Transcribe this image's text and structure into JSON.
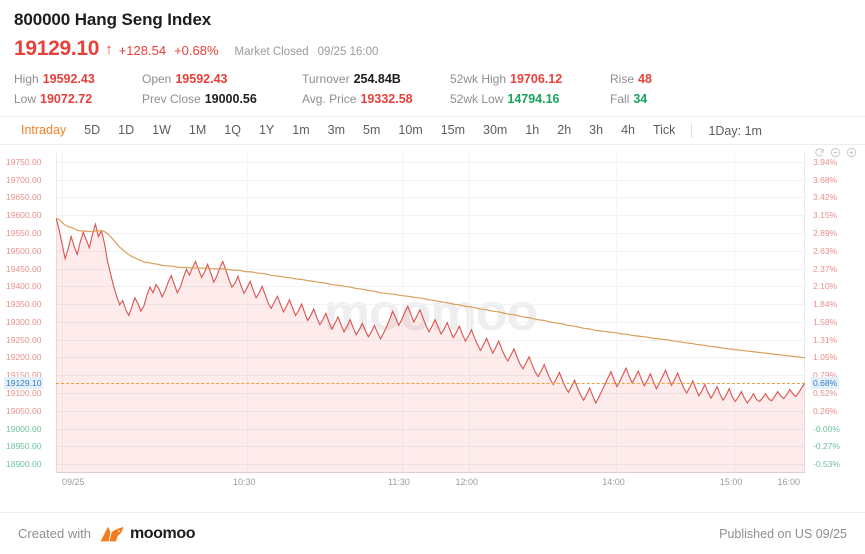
{
  "header": {
    "symbol_title": "800000 Hang Seng Index",
    "last_price": "19129.10",
    "arrow": "↑",
    "change": "+128.54",
    "change_pct": "+0.68%",
    "market_status": "Market Closed",
    "market_time": "09/25 16:00",
    "accent_up": "#e8403a",
    "accent_down": "#18a45b"
  },
  "stats": {
    "col1": [
      {
        "label": "High",
        "value": "19592.43",
        "color": "red"
      },
      {
        "label": "Low",
        "value": "19072.72",
        "color": "red"
      }
    ],
    "col2": [
      {
        "label": "Open",
        "value": "19592.43",
        "color": "red"
      },
      {
        "label": "Prev Close",
        "value": "19000.56",
        "color": "dark"
      }
    ],
    "col3": [
      {
        "label": "Turnover",
        "value": "254.84B",
        "color": "dark"
      },
      {
        "label": "Avg. Price",
        "value": "19332.58",
        "color": "red"
      }
    ],
    "col4": [
      {
        "label": "52wk High",
        "value": "19706.12",
        "color": "red"
      },
      {
        "label": "52wk Low",
        "value": "14794.16",
        "color": "green"
      }
    ],
    "col5": [
      {
        "label": "Rise",
        "value": "48",
        "color": "red"
      },
      {
        "label": "Fall",
        "value": "34",
        "color": "green"
      }
    ]
  },
  "tabs": {
    "items": [
      "Intraday",
      "5D",
      "1D",
      "1W",
      "1M",
      "1Q",
      "1Y",
      "1m",
      "3m",
      "5m",
      "10m",
      "15m",
      "30m",
      "1h",
      "2h",
      "3h",
      "4h",
      "Tick"
    ],
    "active": "Intraday",
    "period_label": "1Day: 1m"
  },
  "chart_controls": {
    "reset_icon": "refresh-icon",
    "zoom_out_icon": "zoom-out-icon",
    "zoom_in_icon": "zoom-in-icon"
  },
  "chart_data": {
    "type": "line",
    "title": "800000 Hang Seng Index Intraday",
    "xlabel": "",
    "ylabel": "",
    "grid": true,
    "legend": false,
    "watermark": "moomoo",
    "ylim": [
      18875,
      19775
    ],
    "y_ticks": [
      {
        "value": 19750,
        "label": "19750.00",
        "color": "red"
      },
      {
        "value": 19700,
        "label": "19700.00",
        "color": "red"
      },
      {
        "value": 19650,
        "label": "19650.00",
        "color": "red"
      },
      {
        "value": 19600,
        "label": "19600.00",
        "color": "red"
      },
      {
        "value": 19550,
        "label": "19550.00",
        "color": "red"
      },
      {
        "value": 19500,
        "label": "19500.00",
        "color": "red"
      },
      {
        "value": 19450,
        "label": "19450.00",
        "color": "red"
      },
      {
        "value": 19400,
        "label": "19400.00",
        "color": "red"
      },
      {
        "value": 19350,
        "label": "19350.00",
        "color": "red"
      },
      {
        "value": 19300,
        "label": "19300.00",
        "color": "red"
      },
      {
        "value": 19250,
        "label": "19250.00",
        "color": "red"
      },
      {
        "value": 19200,
        "label": "19200.00",
        "color": "red"
      },
      {
        "value": 19150,
        "label": "19150.00",
        "color": "red"
      },
      {
        "value": 19100,
        "label": "19100.00",
        "color": "red"
      },
      {
        "value": 19050,
        "label": "19050.00",
        "color": "red"
      },
      {
        "value": 19000,
        "label": "19000.00",
        "color": "green"
      },
      {
        "value": 18950,
        "label": "18950.00",
        "color": "green"
      },
      {
        "value": 18900,
        "label": "18900.00",
        "color": "green"
      }
    ],
    "y_ticks_right": [
      {
        "value": 19750,
        "label": "3.94%",
        "color": "red"
      },
      {
        "value": 19700,
        "label": "3.68%",
        "color": "red"
      },
      {
        "value": 19650,
        "label": "3.42%",
        "color": "red"
      },
      {
        "value": 19600,
        "label": "3.15%",
        "color": "red"
      },
      {
        "value": 19550,
        "label": "2.89%",
        "color": "red"
      },
      {
        "value": 19500,
        "label": "2.63%",
        "color": "red"
      },
      {
        "value": 19450,
        "label": "2.37%",
        "color": "red"
      },
      {
        "value": 19400,
        "label": "2.10%",
        "color": "red"
      },
      {
        "value": 19350,
        "label": "1.84%",
        "color": "red"
      },
      {
        "value": 19300,
        "label": "1.58%",
        "color": "red"
      },
      {
        "value": 19250,
        "label": "1.31%",
        "color": "red"
      },
      {
        "value": 19200,
        "label": "1.05%",
        "color": "red"
      },
      {
        "value": 19150,
        "label": "0.79%",
        "color": "red"
      },
      {
        "value": 19100,
        "label": "0.52%",
        "color": "red"
      },
      {
        "value": 19050,
        "label": "0.26%",
        "color": "red"
      },
      {
        "value": 19000,
        "label": "-0.00%",
        "color": "green"
      },
      {
        "value": 18950,
        "label": "-0.27%",
        "color": "green"
      },
      {
        "value": 18900,
        "label": "-0.53%",
        "color": "green"
      }
    ],
    "current_price_marker": {
      "value": 19129.1,
      "left_label": "19129.10",
      "right_label": "0.68%",
      "line_color": "#e9a23b",
      "style": "dashed"
    },
    "x_ticks": [
      {
        "pos": 0.008,
        "label": "09/25"
      },
      {
        "pos": 0.255,
        "label": "10:30"
      },
      {
        "pos": 0.462,
        "label": "11:30"
      },
      {
        "pos": 0.552,
        "label": "12:00"
      },
      {
        "pos": 0.748,
        "label": "14:00"
      },
      {
        "pos": 0.905,
        "label": "15:00"
      },
      {
        "pos": 0.998,
        "label": "16:00"
      }
    ],
    "series": [
      {
        "name": "Price",
        "color": "#d9534f",
        "fill": "rgba(232,64,58,0.10)",
        "values": [
          19592,
          19560,
          19520,
          19478,
          19505,
          19540,
          19512,
          19490,
          19525,
          19552,
          19530,
          19508,
          19545,
          19575,
          19540,
          19556,
          19520,
          19470,
          19435,
          19400,
          19372,
          19348,
          19360,
          19335,
          19318,
          19342,
          19368,
          19352,
          19330,
          19345,
          19375,
          19398,
          19382,
          19405,
          19392,
          19370,
          19388,
          19412,
          19430,
          19406,
          19382,
          19398,
          19424,
          19448,
          19432,
          19452,
          19470,
          19448,
          19425,
          19440,
          19462,
          19438,
          19412,
          19428,
          19452,
          19470,
          19446,
          19420,
          19398,
          19408,
          19428,
          19402,
          19380,
          19396,
          19414,
          19390,
          19368,
          19382,
          19400,
          19376,
          19352,
          19338,
          19356,
          19372,
          19350,
          19328,
          19344,
          19362,
          19340,
          19318,
          19332,
          19350,
          19326,
          19304,
          19318,
          19336,
          19312,
          19292,
          19306,
          19324,
          19300,
          19280,
          19296,
          19314,
          19292,
          19272,
          19288,
          19306,
          19284,
          19264,
          19278,
          19296,
          19276,
          19258,
          19272,
          19290,
          19270,
          19252,
          19268,
          19286,
          19306,
          19330,
          19312,
          19290,
          19306,
          19326,
          19344,
          19322,
          19300,
          19316,
          19334,
          19312,
          19290,
          19272,
          19288,
          19306,
          19286,
          19266,
          19280,
          19298,
          19276,
          19256,
          19270,
          19288,
          19266,
          19246,
          19260,
          19278,
          19256,
          19236,
          19220,
          19236,
          19254,
          19232,
          19212,
          19228,
          19246,
          19224,
          19204,
          19190,
          19206,
          19224,
          19202,
          19182,
          19168,
          19184,
          19202,
          19180,
          19160,
          19146,
          19162,
          19180,
          19158,
          19138,
          19124,
          19140,
          19158,
          19136,
          19116,
          19102,
          19118,
          19136,
          19114,
          19094,
          19080,
          19096,
          19114,
          19092,
          19072,
          19088,
          19106,
          19124,
          19142,
          19160,
          19138,
          19118,
          19134,
          19152,
          19170,
          19148,
          19128,
          19144,
          19162,
          19140,
          19120,
          19136,
          19154,
          19132,
          19112,
          19128,
          19146,
          19164,
          19142,
          19122,
          19138,
          19156,
          19134,
          19114,
          19100,
          19116,
          19134,
          19112,
          19092,
          19106,
          19124,
          19102,
          19086,
          19100,
          19118,
          19096,
          19080,
          19094,
          19112,
          19090,
          19076,
          19088,
          19104,
          19086,
          19072,
          19084,
          19098,
          19082,
          19076,
          19086,
          19098,
          19084,
          19078,
          19090,
          19104,
          19092,
          19084,
          19096,
          19110,
          19098,
          19090,
          19102,
          19116,
          19129
        ]
      },
      {
        "name": "Avg. Price",
        "color": "#d9a05b",
        "values": [
          19592,
          19588,
          19580,
          19572,
          19568,
          19566,
          19562,
          19558,
          19556,
          19556,
          19555,
          19554,
          19554,
          19556,
          19556,
          19556,
          19554,
          19548,
          19540,
          19530,
          19520,
          19510,
          19503,
          19496,
          19489,
          19484,
          19480,
          19476,
          19472,
          19469,
          19467,
          19466,
          19464,
          19463,
          19461,
          19459,
          19458,
          19457,
          19457,
          19456,
          19454,
          19453,
          19453,
          19453,
          19452,
          19452,
          19452,
          19452,
          19451,
          19451,
          19451,
          19450,
          19449,
          19449,
          19449,
          19449,
          19448,
          19447,
          19446,
          19445,
          19445,
          19444,
          19442,
          19441,
          19441,
          19440,
          19438,
          19437,
          19436,
          19435,
          19433,
          19431,
          19430,
          19429,
          19428,
          19426,
          19425,
          19424,
          19423,
          19421,
          19420,
          19419,
          19418,
          19416,
          19415,
          19414,
          19412,
          19411,
          19410,
          19409,
          19407,
          19405,
          19404,
          19403,
          19402,
          19400,
          19399,
          19398,
          19396,
          19394,
          19393,
          19392,
          19390,
          19388,
          19387,
          19386,
          19384,
          19382,
          19381,
          19380,
          19379,
          19378,
          19377,
          19375,
          19374,
          19373,
          19372,
          19371,
          19369,
          19368,
          19367,
          19366,
          19364,
          19362,
          19361,
          19360,
          19358,
          19356,
          19355,
          19354,
          19352,
          19350,
          19349,
          19348,
          19346,
          19344,
          19343,
          19342,
          19340,
          19338,
          19336,
          19335,
          19334,
          19332,
          19330,
          19329,
          19328,
          19326,
          19324,
          19322,
          19321,
          19320,
          19318,
          19316,
          19314,
          19313,
          19312,
          19310,
          19308,
          19306,
          19305,
          19304,
          19302,
          19300,
          19298,
          19297,
          19296,
          19294,
          19292,
          19290,
          19289,
          19288,
          19286,
          19284,
          19282,
          19281,
          19280,
          19278,
          19276,
          19275,
          19274,
          19273,
          19272,
          19271,
          19270,
          19269,
          19267,
          19266,
          19265,
          19264,
          19262,
          19261,
          19260,
          19259,
          19258,
          19257,
          19255,
          19254,
          19253,
          19252,
          19251,
          19250,
          19249,
          19247,
          19246,
          19245,
          19244,
          19242,
          19241,
          19240,
          19239,
          19237,
          19236,
          19235,
          19234,
          19232,
          19231,
          19230,
          19229,
          19228,
          19226,
          19225,
          19224,
          19223,
          19222,
          19221,
          19220,
          19219,
          19218,
          19217,
          19216,
          19215,
          19214,
          19213,
          19212,
          19211,
          19210,
          19209,
          19208,
          19207,
          19206,
          19205,
          19204,
          19203,
          19202,
          19201,
          19200,
          19199
        ]
      }
    ]
  },
  "footer": {
    "created_label": "Created with",
    "brand": "moomoo",
    "published": "Published on US 09/25"
  }
}
